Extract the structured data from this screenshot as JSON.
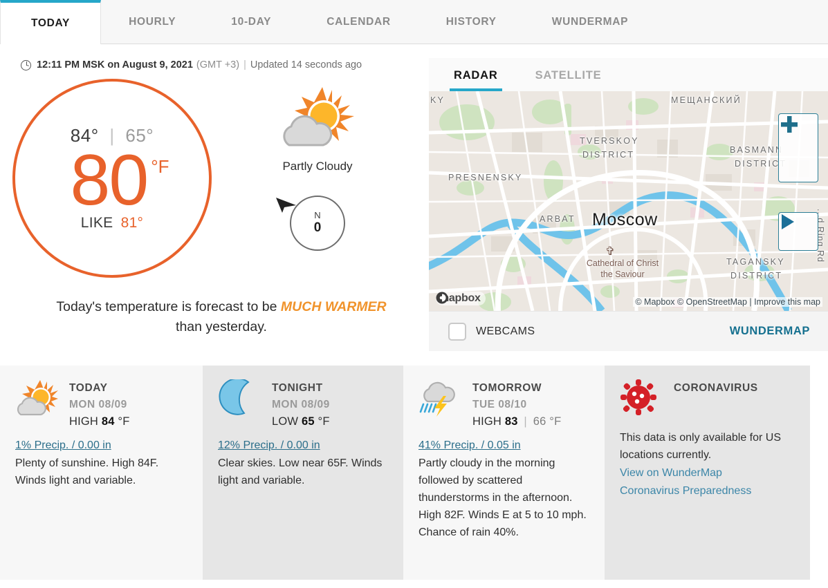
{
  "tabs": [
    {
      "label": "TODAY",
      "active": true
    },
    {
      "label": "HOURLY",
      "active": false
    },
    {
      "label": "10-DAY",
      "active": false
    },
    {
      "label": "CALENDAR",
      "active": false
    },
    {
      "label": "HISTORY",
      "active": false
    },
    {
      "label": "WUNDERMAP",
      "active": false
    }
  ],
  "observation": {
    "time": "12:11 PM MSK on August 9, 2021",
    "gmt_offset": "(GMT +3)",
    "separator": "|",
    "updated": "Updated 14 seconds ago",
    "high": "84°",
    "hilo_bar": "|",
    "low": "65°",
    "current_temp": "80",
    "unit": "°F",
    "feels_like_label": "LIKE",
    "feels_like": "81°",
    "condition": "Partly Cloudy",
    "wind_direction": "N",
    "wind_speed": "0",
    "accent_color": "#e8622b"
  },
  "forecast_sentence": {
    "prefix": "Today's temperature is forecast to be",
    "emphasis": "MUCH WARMER",
    "suffix": "than yesterday.",
    "emphasis_color": "#f0932b"
  },
  "radar": {
    "tabs": [
      {
        "label": "RADAR",
        "active": true
      },
      {
        "label": "SATELLITE",
        "active": false
      }
    ],
    "accent_color": "#26a7c9",
    "map": {
      "city": "Moscow",
      "district_labels": [
        "KY",
        "МЕЩАНСКИЙ",
        "TVERSKOY",
        "DISTRICT",
        "PRESNENSKY",
        "BASMANN",
        "DISTRICT",
        "ARBAT",
        "TAGANSKY",
        "DISTRICT"
      ],
      "poi": "Cathedral of Christ\nthe Saviour",
      "road_label": "...d Ring Rd",
      "zoom_in_icon": "plus-icon",
      "play_icon": "play-icon",
      "logo": "mapbox",
      "attribution": "© Mapbox © OpenStreetMap | Improve this map",
      "improve_link": "Improve this map"
    },
    "footer": {
      "webcams_label": "WEBCAMS",
      "webcams_checked": false,
      "wundermap_label": "WUNDERMAP",
      "wundermap_color": "#15708f"
    }
  },
  "cards": [
    {
      "title": "TODAY",
      "date": "MON 08/09",
      "temp_label": "HIGH",
      "temp_value": "84",
      "temp_unit": "°F",
      "second_temp": "",
      "precip": "1% Precip. / 0.00 in",
      "description": "Plenty of sunshine. High 84F. Winds light and variable.",
      "icon": "partly-cloudy-day-icon"
    },
    {
      "title": "TONIGHT",
      "date": "MON 08/09",
      "temp_label": "LOW",
      "temp_value": "65",
      "temp_unit": "°F",
      "second_temp": "",
      "precip": "12% Precip. / 0.00 in",
      "description": "Clear skies. Low near 65F. Winds light and variable.",
      "icon": "moon-icon"
    },
    {
      "title": "TOMORROW",
      "date": "TUE 08/10",
      "temp_label": "HIGH",
      "temp_value": "83",
      "temp_unit": "°F",
      "second_temp": "66",
      "precip": "41% Precip. / 0.05 in",
      "description": "Partly cloudy in the morning followed by scattered thunderstorms in the afternoon. High 82F. Winds E at 5 to 10 mph. Chance of rain 40%.",
      "icon": "thunderstorm-icon"
    }
  ],
  "coronavirus": {
    "title": "CORONAVIRUS",
    "icon": "virus-icon",
    "icon_color": "#d42027",
    "text": "This data is only available for US locations currently.",
    "links": [
      "View on WunderMap",
      "Coronavirus Preparedness"
    ],
    "link_color": "#3c86a8"
  }
}
